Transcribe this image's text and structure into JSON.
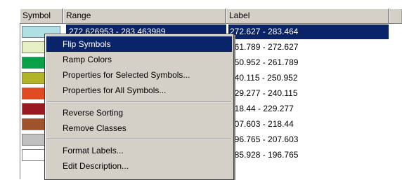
{
  "table": {
    "columns": [
      "Symbol",
      "Range",
      "Label"
    ],
    "rows": [
      {
        "color": "#b0e0e6",
        "range": "272.626953 - 283.463989",
        "label": "272.627 - 283.464",
        "selected": true
      },
      {
        "color": "#e6eec4",
        "range": "",
        "label": "261.789 - 272.627",
        "selected": false
      },
      {
        "color": "#0aa04a",
        "range": "",
        "label": "250.952 - 261.789",
        "selected": false
      },
      {
        "color": "#b3b32a",
        "range": "",
        "label": "240.115 - 250.952",
        "selected": false
      },
      {
        "color": "#e04a22",
        "range": "",
        "label": "229.277 - 240.115",
        "selected": false
      },
      {
        "color": "#9a1a20",
        "range": "",
        "label": "218.44 - 229.277",
        "selected": false
      },
      {
        "color": "#a0522d",
        "range": "",
        "label": "207.603 - 218.44",
        "selected": false
      },
      {
        "color": "#c0c0c0",
        "range": "",
        "label": "196.765 - 207.603",
        "selected": false
      },
      {
        "color": "#ffffff",
        "range": "",
        "label": "185.928 - 196.765",
        "selected": false
      }
    ]
  },
  "context_menu": {
    "groups": [
      [
        "Flip Symbols",
        "Ramp Colors",
        "Properties for Selected Symbols...",
        "Properties for All Symbols..."
      ],
      [
        "Reverse Sorting",
        "Remove Classes"
      ],
      [
        "Format Labels...",
        "Edit Description..."
      ]
    ],
    "highlighted": "Flip Symbols"
  }
}
